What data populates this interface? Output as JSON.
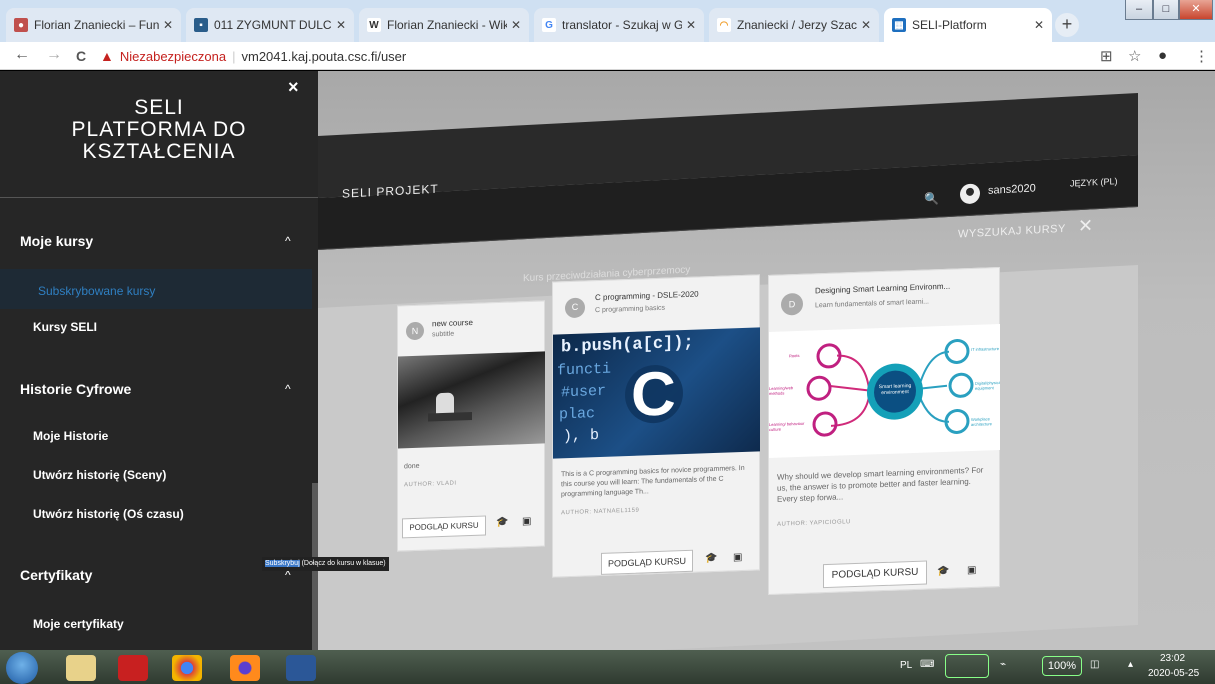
{
  "browser": {
    "tabs": [
      {
        "title": "Florian Znaniecki – Fund",
        "favicon": "person-favicon",
        "color": "#c0504d"
      },
      {
        "title": "011 ZYGMUNT DULCZEW",
        "favicon": "page-favicon",
        "color": "#2a5d8a"
      },
      {
        "title": "Florian Znaniecki - Wikip",
        "favicon": "wikipedia-favicon",
        "color": "#555555"
      },
      {
        "title": "translator - Szukaj w Goo",
        "favicon": "google-favicon",
        "color": "#4285f4"
      },
      {
        "title": "Znaniecki / Jerzy Szacki.",
        "favicon": "arc-favicon",
        "color": "#f0a030"
      },
      {
        "title": "SELI-Platform",
        "favicon": "seli-favicon",
        "color": "#1e6fbf"
      }
    ],
    "new_tab": "+",
    "window_controls": [
      "–",
      "□",
      "✕"
    ],
    "address": {
      "insecure_label": "Niezabezpieczona",
      "separator": "|",
      "url": "vm2041.kaj.pouta.csc.fi/user"
    },
    "nav": {
      "back": "←",
      "forward": "→",
      "reload": "C"
    },
    "tools": {
      "translate": "⊞",
      "star": "☆",
      "account": "●",
      "menu": "⋮"
    }
  },
  "sidebar": {
    "close": "×",
    "title": "SELI PLATFORMA DO KSZTAŁCENIA",
    "sections": [
      {
        "heading": "Moje kursy",
        "chevron": "^",
        "items": [
          "Subskrybowane kursy",
          "Kursy SELI"
        ]
      },
      {
        "heading": "Historie Cyfrowe",
        "chevron": "^",
        "items": [
          "Moje Historie",
          "Utwórz historię (Sceny)",
          "Utwórz historię (Oś czasu)"
        ]
      },
      {
        "heading": "Certyfikaty",
        "chevron": "^",
        "items": [
          "Moje certyfikaty"
        ]
      }
    ],
    "active_item": "Subskrybowane kursy"
  },
  "tooltip": {
    "highlight": "Subskrybuj",
    "rest": " (Dołącz do kursu w klasue)"
  },
  "site": {
    "brand": "SELI PROJEKT",
    "course_bar_title": "Kurs przeciwdziałania cyberprzemocy",
    "search_icon": "search-icon",
    "username": "sans2020",
    "language": "JĘZYK (PL)",
    "search_courses": "WYSZUKAJ KURSY",
    "close": "✕"
  },
  "courses": [
    {
      "initial": "N",
      "title": "new course",
      "subtitle": "subtitle",
      "description": "done",
      "author": "AUTHOR: VLADI",
      "button": "PODGLĄD KURSU",
      "image": "photo-bw"
    },
    {
      "initial": "C",
      "title": "C programming - DSLE-2020",
      "subtitle": "C programming basics",
      "description": "This is a C programming basics for novice programmers. In this course you will learn: The fundamentals of the C programming language Th...",
      "author": "AUTHOR: NATNAEL1159",
      "button": "PODGLĄD KURSU",
      "image": "c-code",
      "image_code": [
        "b.push(a[c]);",
        "functi",
        "#user",
        "plac",
        "), b"
      ],
      "image_letter": "C"
    },
    {
      "initial": "D",
      "title": "Designing Smart Learning Environm...",
      "subtitle": "Learn fundamentals of smart learni...",
      "description": "Why should we develop smart learning environments? For us, the answer is to promote better and faster learning. Every step forwa...",
      "author": "AUTHOR: YAPICIOGLU",
      "button": "PODGLĄD KURSU",
      "image": "diagram",
      "diagram": {
        "center": "Smart learning environment",
        "left": [
          "Roots",
          "Learning/web methods",
          "Learning/ behaviour culture"
        ],
        "right": [
          "IT infrastructure",
          "Digital/physical equipment",
          "Workplace architecture"
        ]
      }
    }
  ],
  "taskbar": {
    "apps": [
      "explorer-icon",
      "pdf-icon",
      "chrome-icon",
      "firefox-icon",
      "word-icon"
    ],
    "lang": "PL",
    "battery": "100%",
    "time": "23:02",
    "date": "2020-05-25"
  }
}
